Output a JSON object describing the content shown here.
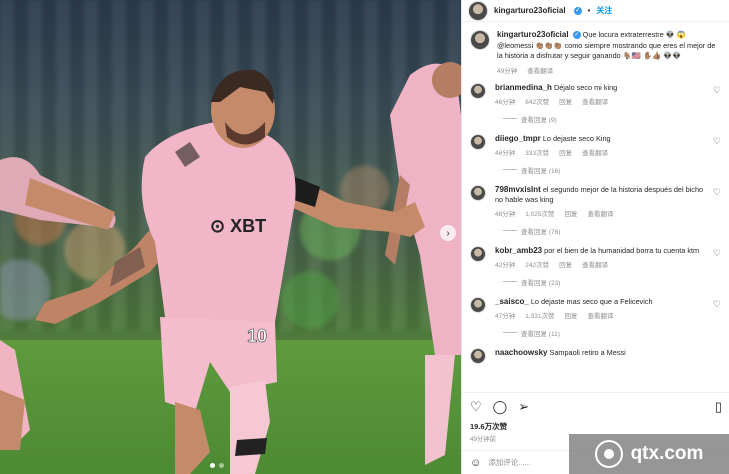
{
  "post": {
    "username": "kingarturo23oficial",
    "follow_label": "关注",
    "caption_text": "Que locura extraterrestre 👽 😱 @leomessi 👏🏽👏🏽👏🏽 como siempre mostrando que eres el mejor de la historia a disfrutar y seguir ganando 🐐🇺🇸 ✋🏽👍🏽 👽👽",
    "caption_time": "49分钟",
    "caption_translate": "查看翻译",
    "likes": "19.6万次赞",
    "time_ago": "49分钟前",
    "add_comment_placeholder": "添加评论......",
    "carousel_next": "›"
  },
  "comments": [
    {
      "user": "brianmedina_h",
      "text": "Déjalo seco mi king",
      "time": "46分钟",
      "likes": "842次赞",
      "reply": "回复",
      "translate": "查看翻译",
      "view_replies": "查看回复 (9)"
    },
    {
      "user": "diiego_tmpr",
      "text": "Lo dejaste seco King",
      "time": "46分钟",
      "likes": "333次赞",
      "reply": "回复",
      "translate": "查看翻译",
      "view_replies": "查看回复 (16)"
    },
    {
      "user": "798mvxislnt",
      "text": "el segundo mejor de la historia después del bicho no hable was king",
      "time": "48分钟",
      "likes": "1,025次赞",
      "reply": "回复",
      "translate": "查看翻译",
      "view_replies": "查看回复 (76)"
    },
    {
      "user": "kobr_amb23",
      "text": "por el bien de la humanidad borra tu cuenta ktm",
      "time": "42分钟",
      "likes": "242次赞",
      "reply": "回复",
      "translate": "查看翻译",
      "view_replies": "查看回复 (23)"
    },
    {
      "user": "_saisco_",
      "text": "Lo dejaste mas seco que a Felicevich",
      "time": "47分钟",
      "likes": "1,331次赞",
      "reply": "回复",
      "translate": "查看翻译",
      "view_replies": "查看回复 (11)"
    },
    {
      "user": "naachoowsky",
      "text": "Sampaoli retiro a Messi"
    }
  ],
  "watermark": {
    "text": "qtx.com"
  },
  "icons": [
    "heart-icon",
    "comment-icon",
    "share-icon",
    "bookmark-icon",
    "emoji-icon",
    "verified-badge-icon",
    "chevron-right-icon"
  ],
  "colors": {
    "accent": "#0095f6",
    "jersey_pink": "#f2b6c9",
    "pitch_green": "#5a9440"
  }
}
